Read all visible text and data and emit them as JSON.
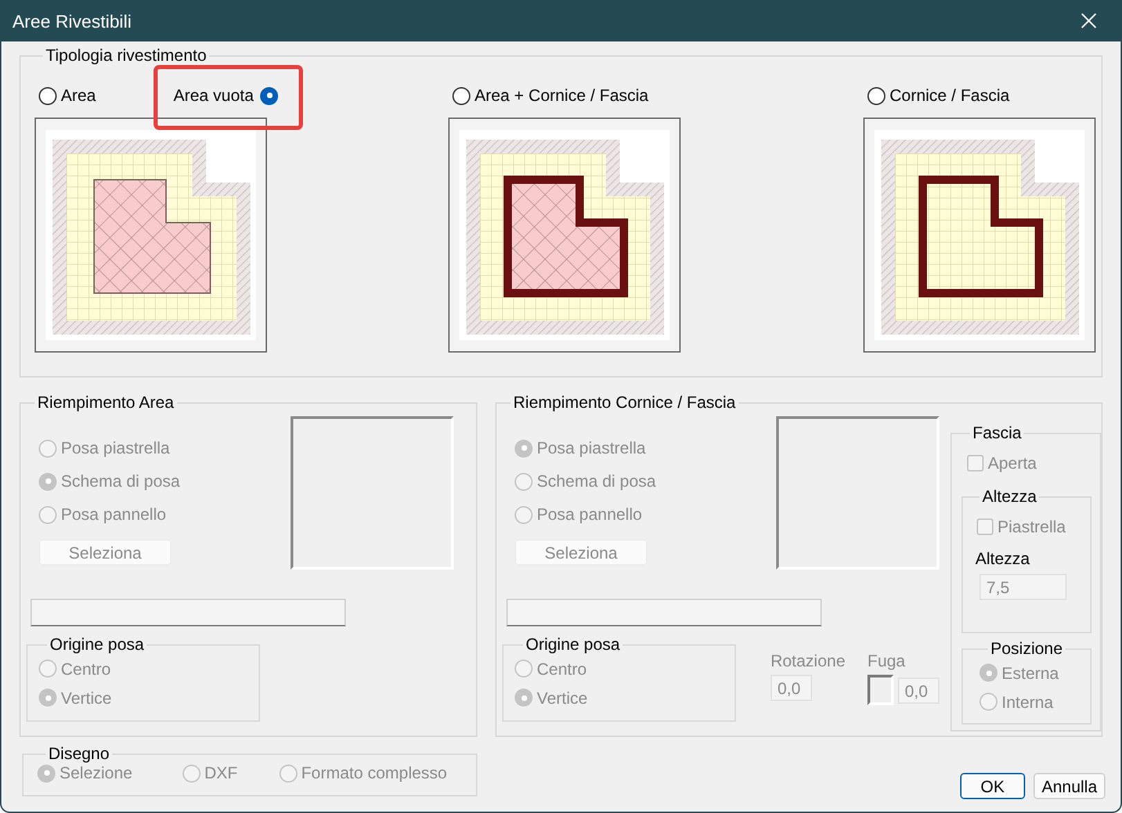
{
  "window": {
    "title": "Aree Rivestibili"
  },
  "tipologia": {
    "label": "Tipologia rivestimento",
    "options": [
      {
        "label": "Area",
        "selected": false,
        "highlighted": false,
        "label_first": false
      },
      {
        "label": "Area vuota",
        "selected": true,
        "highlighted": true,
        "label_first": true
      },
      {
        "label": "Area + Cornice / Fascia",
        "selected": false,
        "highlighted": false,
        "label_first": false
      },
      {
        "label": "Cornice / Fascia",
        "selected": false,
        "highlighted": false,
        "label_first": false
      }
    ],
    "previews": [
      {
        "kind": "empty_area"
      },
      {
        "kind": "area_frame"
      },
      {
        "kind": "frame"
      }
    ]
  },
  "riempimento_area": {
    "label": "Riempimento Area",
    "disabled": true,
    "modes": [
      {
        "label": "Posa piastrella",
        "selected": false
      },
      {
        "label": "Schema di posa",
        "selected": true
      },
      {
        "label": "Posa pannello",
        "selected": false
      }
    ],
    "select_button": "Seleziona",
    "origin": {
      "label": "Origine posa",
      "options": [
        {
          "label": "Centro",
          "selected": false
        },
        {
          "label": "Vertice",
          "selected": true
        }
      ]
    }
  },
  "riempimento_cornice": {
    "label": "Riempimento Cornice / Fascia",
    "disabled": true,
    "modes": [
      {
        "label": "Posa piastrella",
        "selected": true
      },
      {
        "label": "Schema di posa",
        "selected": false
      },
      {
        "label": "Posa pannello",
        "selected": false
      }
    ],
    "select_button": "Seleziona",
    "origin": {
      "label": "Origine posa",
      "options": [
        {
          "label": "Centro",
          "selected": false
        },
        {
          "label": "Vertice",
          "selected": true
        }
      ]
    },
    "rotation": {
      "label": "Rotazione",
      "value": "0,0"
    },
    "joint": {
      "label": "Fuga",
      "value": "0,0"
    }
  },
  "fascia": {
    "label": "Fascia",
    "disabled": true,
    "open": {
      "label": "Aperta",
      "checked": false
    },
    "height": {
      "label": "Altezza",
      "tile": {
        "label": "Piastrella",
        "checked": false
      },
      "value_label": "Altezza",
      "value": "7,5"
    },
    "position": {
      "label": "Posizione",
      "options": [
        {
          "label": "Esterna",
          "selected": true
        },
        {
          "label": "Interna",
          "selected": false
        }
      ]
    }
  },
  "disegno": {
    "label": "Disegno",
    "disabled": true,
    "options": [
      {
        "label": "Selezione",
        "selected": true
      },
      {
        "label": "DXF",
        "selected": false
      },
      {
        "label": "Formato complesso",
        "selected": false
      }
    ]
  },
  "buttons": [
    {
      "label": "OK",
      "default": true
    },
    {
      "label": "Annulla",
      "default": false
    }
  ]
}
